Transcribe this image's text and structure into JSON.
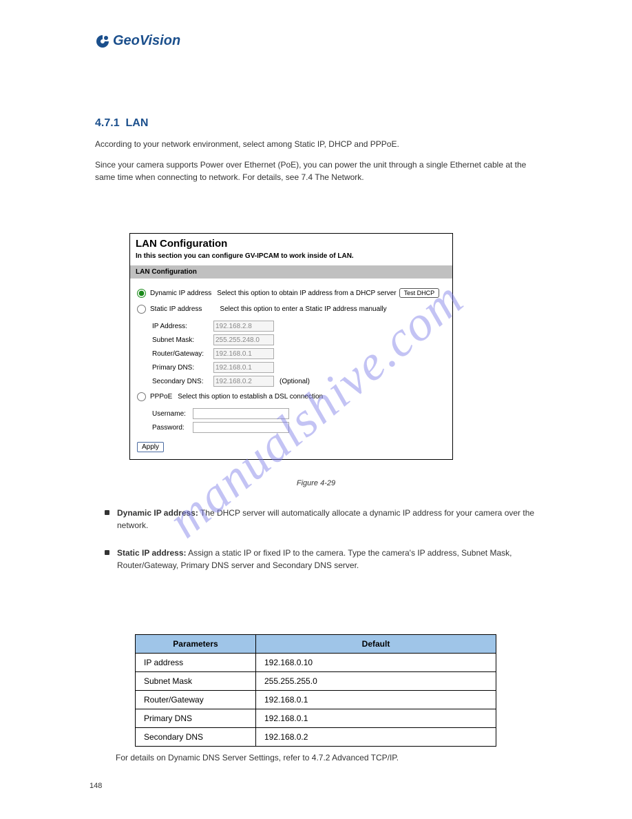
{
  "logo_text": "GeoVision",
  "section_number": "4.7.1",
  "section_title": "LAN",
  "intro_p1": "According to your network environment, select among Static IP, DHCP and PPPoE.",
  "intro_p2": "Since your camera supports Power over Ethernet (PoE), you can power the unit through a single Ethernet cable at the same time when connecting to network. For details, see 7.4 The Network.",
  "panel": {
    "title": "LAN Configuration",
    "desc": "In this section you can configure GV-IPCAM to work inside of LAN.",
    "subheader": "LAN Configuration",
    "dynamic": {
      "label": "Dynamic IP address",
      "desc": "Select this option to obtain IP address from a DHCP server",
      "test_btn": "Test DHCP"
    },
    "static": {
      "label": "Static IP address",
      "desc": "Select this option to enter a Static IP address manually",
      "ip_label": "IP Address:",
      "ip_value": "192.168.2.8",
      "subnet_label": "Subnet Mask:",
      "subnet_value": "255.255.248.0",
      "router_label": "Router/Gateway:",
      "router_value": "192.168.0.1",
      "pdns_label": "Primary DNS:",
      "pdns_value": "192.168.0.1",
      "sdns_label": "Secondary DNS:",
      "sdns_value": "192.168.0.2",
      "optional": "(Optional)"
    },
    "pppoe": {
      "label": "PPPoE",
      "desc": "Select this option to establish a DSL connection",
      "user_label": "Username:",
      "pass_label": "Password:"
    },
    "apply": "Apply"
  },
  "figure_caption": "Figure 4-29",
  "bullet_dynamic": {
    "label": "Dynamic IP address:",
    "text": " The DHCP server will automatically allocate a dynamic IP address for your camera over the network."
  },
  "bullet_static": {
    "label": "Static IP address:",
    "text": " Assign a static IP or fixed IP to the camera. Type the camera's IP address, Subnet Mask, Router/Gateway, Primary DNS server and Secondary DNS server."
  },
  "table": {
    "h1": "Parameters",
    "h2": "Default",
    "rows": [
      [
        "IP address",
        "192.168.0.10"
      ],
      [
        "Subnet Mask",
        "255.255.255.0"
      ],
      [
        "Router/Gateway",
        "192.168.0.1"
      ],
      [
        "Primary DNS",
        "192.168.0.1"
      ],
      [
        "Secondary DNS",
        "192.168.0.2"
      ]
    ]
  },
  "footer_text": "For details on Dynamic DNS Server Settings, refer to 4.7.2 Advanced TCP/IP.",
  "page_number": "148",
  "watermark": "manualshive.com"
}
